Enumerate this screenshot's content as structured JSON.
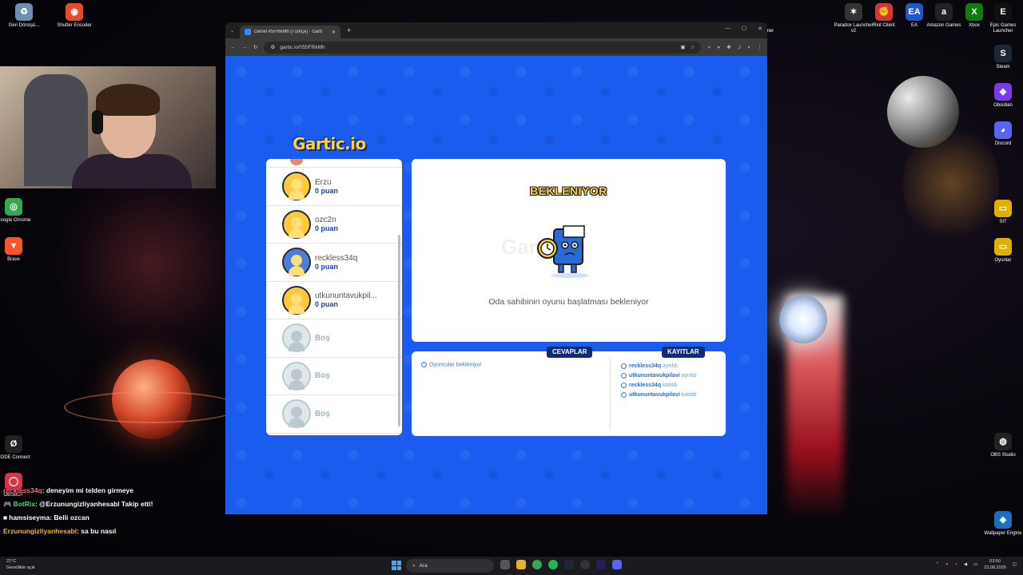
{
  "desktop": {
    "left_icons": [
      {
        "label": "Geri Dönüşü...",
        "color": "#6f8fb0",
        "glyph": "♻"
      },
      {
        "label": "Shutter Encoder",
        "color": "#e84a2a",
        "glyph": "◉"
      },
      {
        "label": "Google Chrome",
        "color": "#34a853",
        "glyph": "◎"
      },
      {
        "label": "Brave",
        "color": "#fb542b",
        "glyph": "▼"
      },
      {
        "label": "RODE Connect",
        "color": "#222222",
        "glyph": "Ø"
      },
      {
        "label": "OBSBOT",
        "color": "#d8344a",
        "glyph": "◯"
      }
    ],
    "right_icons": [
      {
        "label": "Paradox Launcher v2",
        "color": "#333333",
        "glyph": "✶"
      },
      {
        "label": "Riot Client",
        "color": "#d13639",
        "glyph": "✊"
      },
      {
        "label": "EA",
        "color": "#2255cc",
        "glyph": "EA"
      },
      {
        "label": "Amazon Games",
        "color": "#222222",
        "glyph": "a"
      },
      {
        "label": "Xbox",
        "color": "#107c10",
        "glyph": "X"
      },
      {
        "label": "Epic Games Launcher",
        "color": "#111111",
        "glyph": "E"
      },
      {
        "label": "Steam",
        "color": "#1b2838",
        "glyph": "S"
      },
      {
        "label": "Obsidian",
        "color": "#7c3aed",
        "glyph": "◆"
      },
      {
        "label": "Discord",
        "color": "#5865f2",
        "glyph": "◕"
      },
      {
        "label": "SIT",
        "color": "#e0b000",
        "glyph": "▭"
      },
      {
        "label": "Oyunlar",
        "color": "#e0b000",
        "glyph": "▭"
      },
      {
        "label": "OBS Studio",
        "color": "#222222",
        "glyph": "◍"
      },
      {
        "label": "Wallpaper Engine",
        "color": "#1d6fc2",
        "glyph": "◈"
      }
    ],
    "top_extra_label": "mer"
  },
  "chat": [
    {
      "user": "reckless34q",
      "user_color": "#ff6b6b",
      "message": ": deneyim mi telden girmeye"
    },
    {
      "user": "BotRix",
      "user_color": "#4cd964",
      "prefix": "🎮",
      "message": ": @Erzunungizliyanhesabl Takip etti!"
    },
    {
      "user": "hamsiseyma",
      "user_color": "#ffffff",
      "prefix": "■",
      "message": ": Belli ozcan"
    },
    {
      "user": "Erzunungizliyanhesabl",
      "user_color": "#f5b840",
      "message": ": sa bu nasıl"
    }
  ],
  "browser": {
    "tab_title": "Genel #5FRkMh [Türkçe] - Garti",
    "url": "gartic.io/055FRkMh",
    "nav": {
      "back": "←",
      "forward": "→",
      "reload": "↻"
    },
    "window_controls": [
      "—",
      "☐",
      "✕"
    ]
  },
  "game": {
    "logo": "Gartic.io",
    "players": [
      {
        "name": "Erzu",
        "score": "0 puan",
        "avatar": "yellow"
      },
      {
        "name": "ozc2n",
        "score": "0 puan",
        "avatar": "yellow"
      },
      {
        "name": "reckless34q",
        "score": "0 puan",
        "avatar": "hat"
      },
      {
        "name": "utkununtavukpil...",
        "score": "0 puan",
        "avatar": "yellow"
      },
      {
        "name": "Boş",
        "score": "",
        "avatar": "empty"
      },
      {
        "name": "Boş",
        "score": "",
        "avatar": "empty"
      },
      {
        "name": "Boş",
        "score": "",
        "avatar": "empty"
      }
    ],
    "status_title": "BEKLENIYOR",
    "status_text": "Oda sahibinin oyunu başlatması bekleniyor",
    "watermark": "Gartic.io",
    "answers_label": "CEVAPLAR",
    "logs_label": "KAYITLAR",
    "answers_info": "Oyuncular bekleniyor",
    "logs": [
      {
        "user": "reckless34q",
        "action": "ayrıldı"
      },
      {
        "user": "utkununtavukpilavi",
        "action": "ayrıldı"
      },
      {
        "user": "reckless34q",
        "action": "katıldı"
      },
      {
        "user": "utkununtavukpilavi",
        "action": "katıldı"
      }
    ]
  },
  "taskbar": {
    "weather_temp": "21°C",
    "weather_desc": "Genellikle açık",
    "search_placeholder": "Ara",
    "time": "03:50",
    "date": "23.08.2026"
  }
}
